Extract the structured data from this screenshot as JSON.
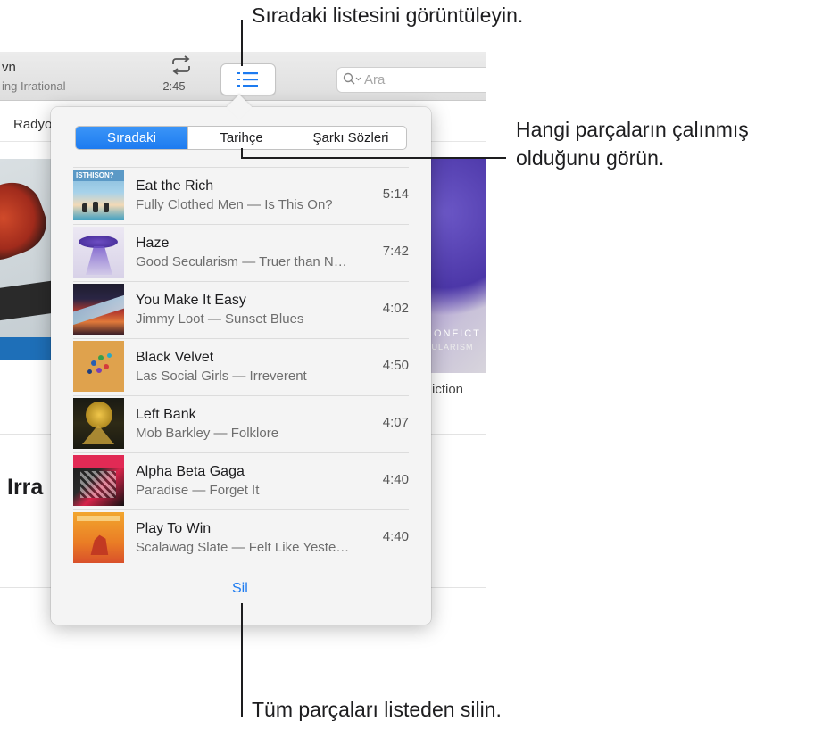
{
  "now_playing": {
    "title_partial": "vn",
    "subtitle_partial": "ing Irrational",
    "time_remaining": "-2:45"
  },
  "search": {
    "placeholder": "Ara"
  },
  "nav": {
    "radio_partial": "Radyo"
  },
  "background": {
    "caption_right": "iction",
    "section_title_partial": "Irra",
    "album_right_line1": "NONFICT",
    "album_right_line2": "CULARISM"
  },
  "popover": {
    "tabs": [
      {
        "label": "Sıradaki",
        "active": true
      },
      {
        "label": "Tarihçe",
        "active": false
      },
      {
        "label": "Şarkı Sözleri",
        "active": false
      }
    ],
    "tracks": [
      {
        "title": "Eat the Rich",
        "subtitle": "Fully Clothed Men — Is This On?",
        "duration": "5:14",
        "art": "beach-art"
      },
      {
        "title": "Haze",
        "subtitle": "Good Secularism — Truer than N…",
        "duration": "7:42",
        "art": "purple-ufo-art"
      },
      {
        "title": "You Make It Easy",
        "subtitle": "Jimmy Loot — Sunset Blues",
        "duration": "4:02",
        "art": "canyon-art"
      },
      {
        "title": "Black Velvet",
        "subtitle": "Las Social Girls — Irreverent",
        "duration": "4:50",
        "art": "dots-art"
      },
      {
        "title": "Left Bank",
        "subtitle": "Mob Barkley — Folklore",
        "duration": "4:07",
        "art": "folklore-art"
      },
      {
        "title": "Alpha Beta Gaga",
        "subtitle": "Paradise — Forget It",
        "duration": "4:40",
        "art": "red-pop-art"
      },
      {
        "title": "Play To Win",
        "subtitle": "Scalawag Slate — Felt Like Yeste…",
        "duration": "4:40",
        "art": "orange-rider-art"
      }
    ],
    "clear_label": "Sil"
  },
  "callouts": {
    "up_next": "Sıradaki listesini görüntüleyin.",
    "history_line1": "Hangi parçaların çalınmış",
    "history_line2": "olduğunu görün.",
    "clear": "Tüm parçaları listeden silin."
  },
  "colors": {
    "accent": "#1d7bf0",
    "popover_bg": "#f4f4f4",
    "toolbar_bg": "#e4e4e4"
  }
}
